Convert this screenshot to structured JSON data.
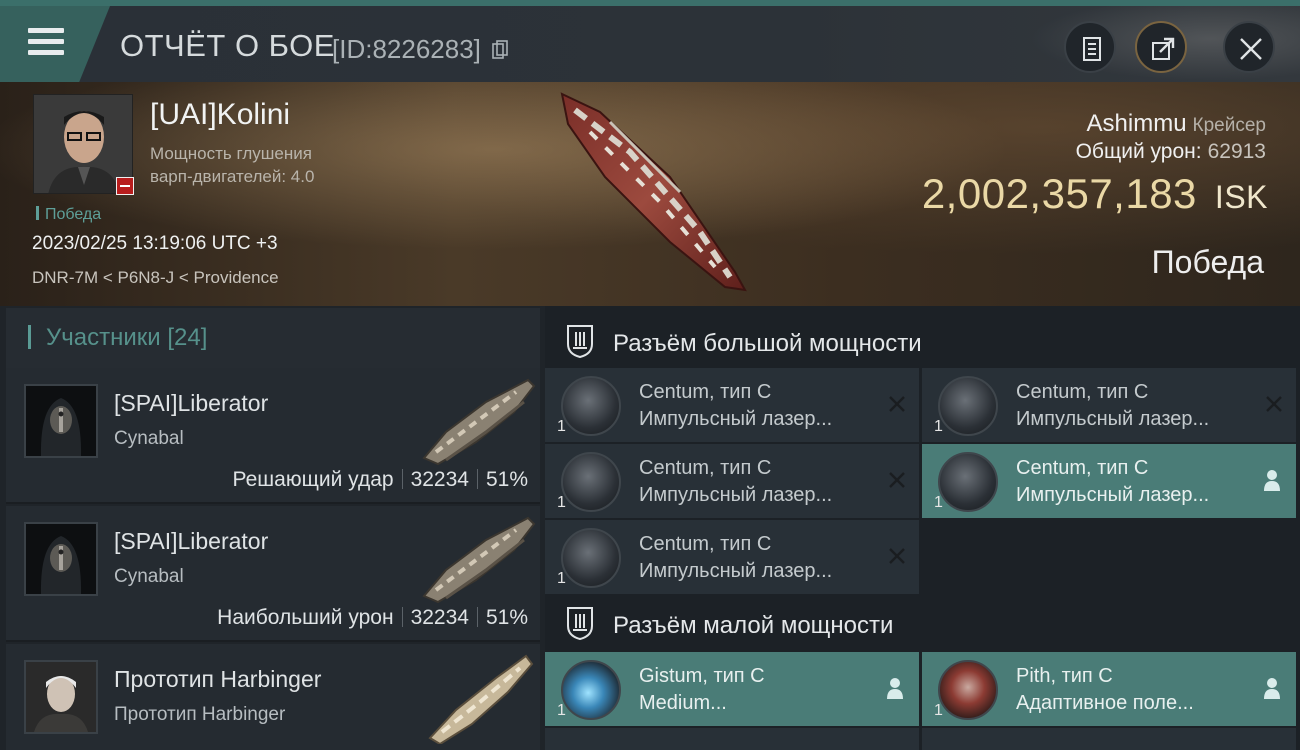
{
  "topbar": {
    "title": "ОТЧЁТ О БОЕ",
    "report_id": "[ID:8226283]",
    "icons": [
      "menu-icon",
      "copy-icon",
      "clipboard-icon",
      "share-icon",
      "close-icon"
    ]
  },
  "victim": {
    "pilot": "[UAI]Kolini",
    "warp_line1": "Мощность глушения",
    "warp_line2": "варп-двигателей: 4.0",
    "result_small": "Победа",
    "datetime": "2023/02/25 13:19:06 UTC +3",
    "location": "DNR-7M < P6N8-J < Providence",
    "ship_name": "Ashimmu",
    "ship_class": "Крейсер",
    "total_damage_label": "Общий урон:",
    "total_damage": "62913",
    "isk_value": "2,002,357,183",
    "isk_unit": "ISK",
    "result_big": "Победа",
    "colors": {
      "isk": "#ead8a6",
      "accent": "#5a9b95"
    }
  },
  "participants": {
    "title": "Участники [24]",
    "rows": [
      {
        "name": "[SPAI]Liberator",
        "ship": "Cynabal",
        "label": "Решающий удар",
        "damage": "32234",
        "percent": "51%"
      },
      {
        "name": "[SPAI]Liberator",
        "ship": "Cynabal",
        "label": "Наибольший урон",
        "damage": "32234",
        "percent": "51%"
      },
      {
        "name": "Прототип Harbinger",
        "ship": "Прототип Harbinger"
      }
    ]
  },
  "fitting": {
    "high_title": "Разъём большой мощности",
    "low_title": "Разъём малой мощности",
    "high": [
      {
        "name": "Centum, тип C",
        "type": "Импульсный лазер...",
        "qty": "1",
        "state": "destroyed"
      },
      {
        "name": "Centum, тип C",
        "type": "Импульсный лазер...",
        "qty": "1",
        "state": "destroyed"
      },
      {
        "name": "Centum, тип C",
        "type": "Импульсный лазер...",
        "qty": "1",
        "state": "destroyed"
      },
      {
        "name": "Centum, тип C",
        "type": "Импульсный лазер...",
        "qty": "1",
        "state": "dropped"
      },
      {
        "name": "Centum, тип C",
        "type": "Импульсный лазер...",
        "qty": "1",
        "state": "destroyed"
      }
    ],
    "low": [
      {
        "name": "Gistum, тип C",
        "type": "Medium...",
        "qty": "1",
        "state": "dropped"
      },
      {
        "name": "Pith, тип C",
        "type": "Адаптивное поле...",
        "qty": "1",
        "state": "dropped"
      }
    ]
  }
}
